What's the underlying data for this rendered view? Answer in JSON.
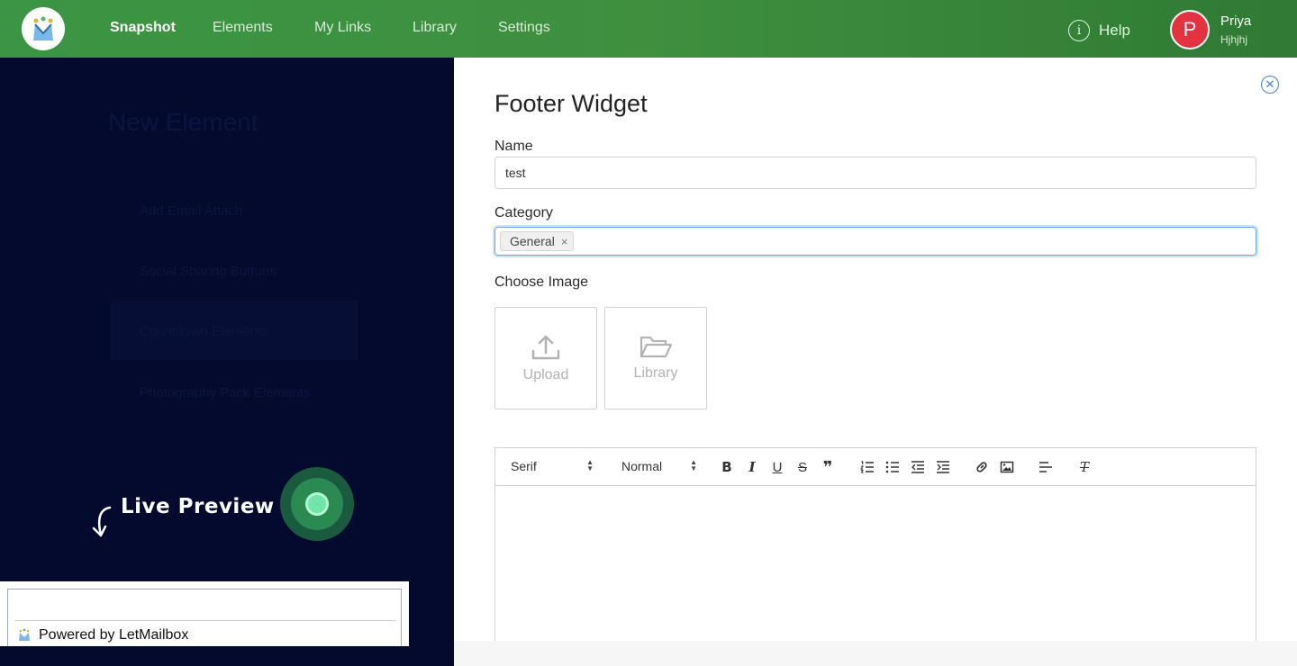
{
  "nav": {
    "items": [
      {
        "label": "Snapshot",
        "active": true
      },
      {
        "label": "Elements",
        "active": false
      },
      {
        "label": "My Links",
        "active": false
      },
      {
        "label": "Library",
        "active": false
      },
      {
        "label": "Settings",
        "active": false
      }
    ],
    "help_label": "Help",
    "help_glyph": "i",
    "user": {
      "initial": "P",
      "name": "Priya",
      "subtitle": "Hjhjhj"
    }
  },
  "background": {
    "title": "New Element",
    "items": [
      "Add Email Attach",
      "Social Sharing Buttons",
      "Countdown Elements",
      "Photography Pack Elements"
    ]
  },
  "live_preview": {
    "label": "Live Preview",
    "powered_by": "Powered by LetMailbox"
  },
  "panel": {
    "title": "Footer Widget",
    "close_glyph": "✕",
    "name_label": "Name",
    "name_value": "test",
    "category_label": "Category",
    "category_tag": "General",
    "tag_remove_glyph": "×",
    "choose_image_label": "Choose Image",
    "upload_label": "Upload",
    "library_label": "Library"
  },
  "editor": {
    "font_select": "Serif",
    "size_select": "Normal",
    "bold": "B",
    "italic": "I",
    "underline": "U",
    "strike": "S",
    "quote": "❞",
    "clean": "T"
  },
  "colors": {
    "nav_green": "#3f8f3f",
    "avatar_red": "#e53241",
    "overlay_navy": "#030a2e",
    "focus_blue": "#6ea8e8"
  }
}
